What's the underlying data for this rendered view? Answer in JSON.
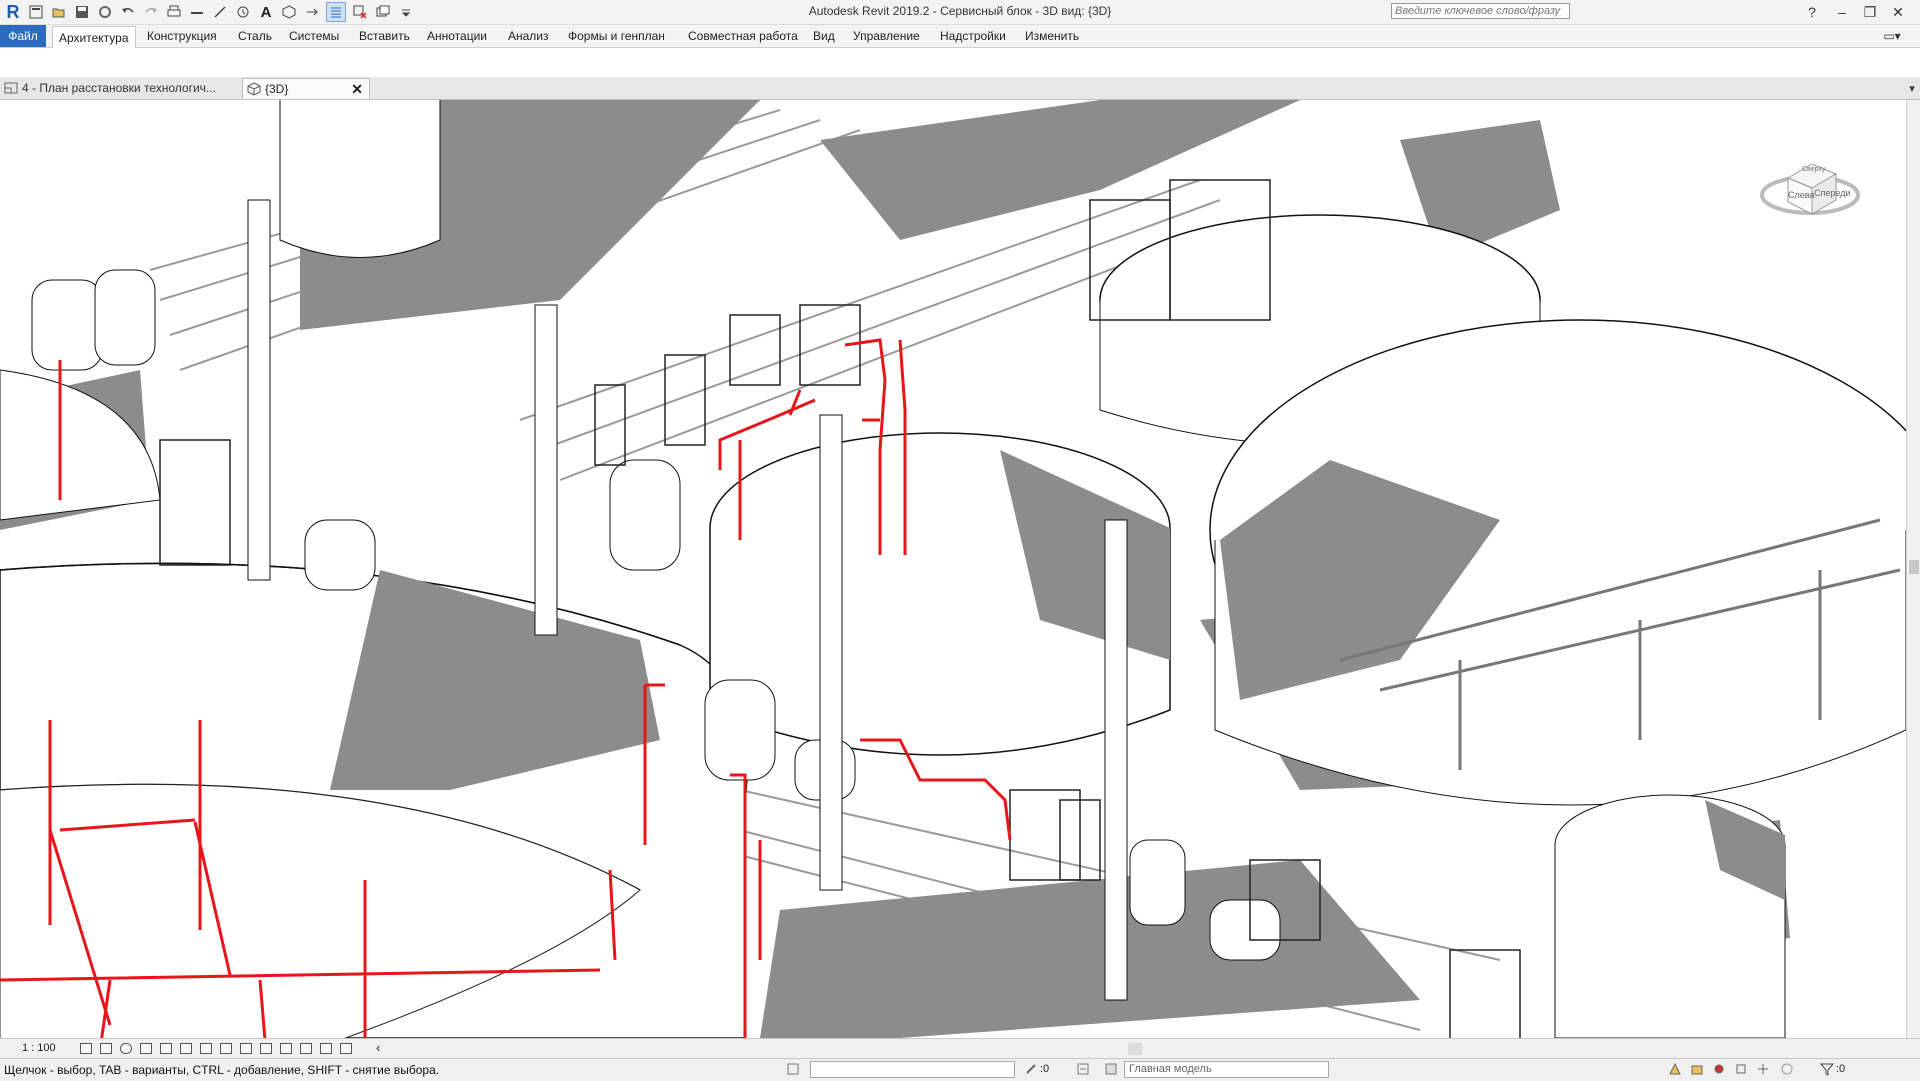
{
  "title_bar": {
    "app_title": "Autodesk Revit 2019.2 - Сервисный блок - 3D вид: {3D}",
    "search_placeholder": "Введите ключевое слово/фразу",
    "logo": "R",
    "quick_access_icons": [
      "open-icon",
      "save-icon",
      "sync-icon",
      "undo-icon",
      "redo-icon",
      "print-icon",
      "measure-icon",
      "dimension-icon",
      "tag-icon",
      "text-icon",
      "3d-view-icon",
      "section-icon",
      "thin-lines-icon",
      "close-hidden-icon",
      "switch-windows-icon",
      "customize-icon"
    ]
  },
  "menu": {
    "file": "Файл",
    "tabs": [
      "Архитектура",
      "Конструкция",
      "Сталь",
      "Системы",
      "Вставить",
      "Аннотации",
      "Анализ",
      "Формы и генплан",
      "Совместная работа",
      "Вид",
      "Управление",
      "Надстройки",
      "Изменить"
    ],
    "active_tab": "Архитектура"
  },
  "view_tabs": [
    {
      "label": "4 - План расстановки технологич...",
      "active": false
    },
    {
      "label": "{3D}",
      "active": true
    }
  ],
  "viewcube": {
    "left_face": "Слева",
    "front_face": "Спереди",
    "top_face": "Сверху"
  },
  "view_control": {
    "scale": "1 : 100"
  },
  "status": {
    "hint": "Щелчок - выбор, TAB - варианты, CTRL - добавление, SHIFT - снятие выбора.",
    "workset_count": ":0",
    "model": "Главная модель",
    "filter_count": ":0"
  },
  "colors": {
    "accent": "#2a6bbf",
    "selection": "#e8151b",
    "shadow": "#8c8c8c"
  }
}
